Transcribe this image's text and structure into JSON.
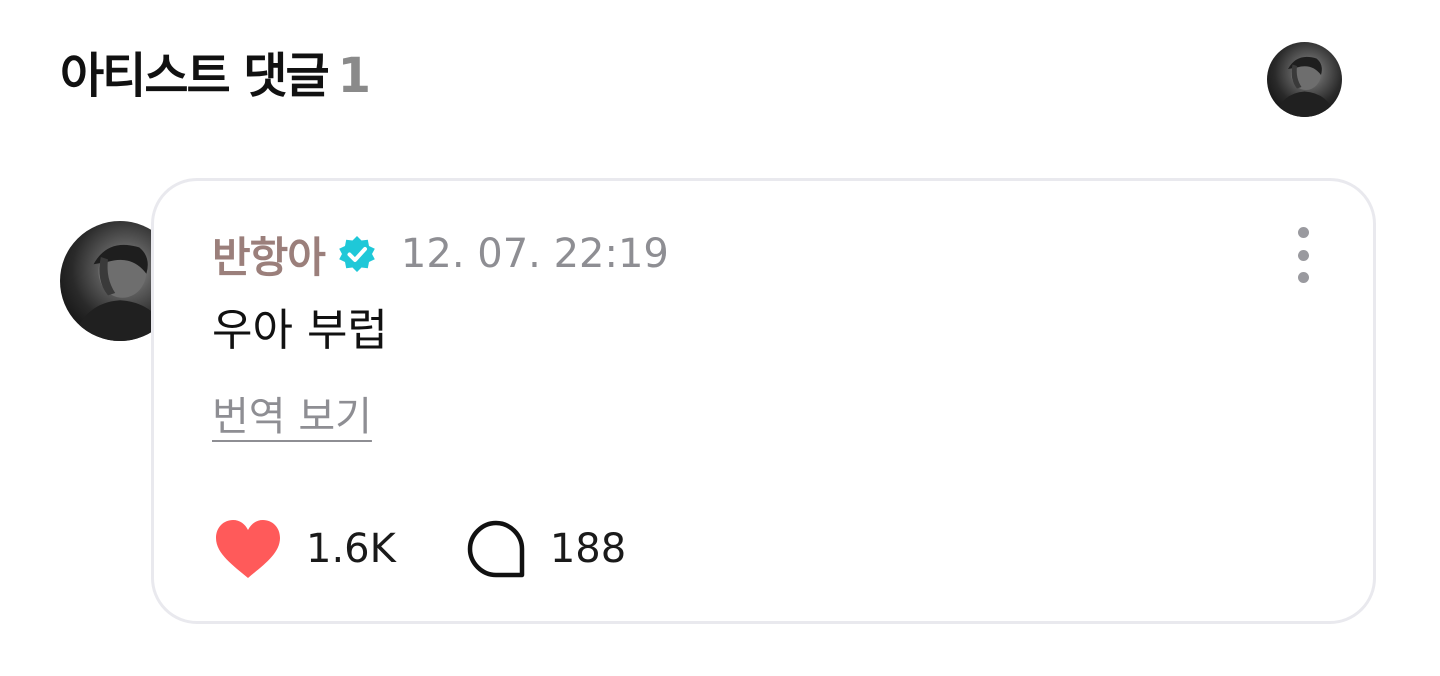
{
  "header": {
    "title": "아티스트 댓글",
    "count": "1"
  },
  "comment": {
    "author": "반항아",
    "timestamp": "12. 07. 22:19",
    "text": "우아 부럽",
    "translate_label": "번역 보기",
    "likes": "1.6K",
    "replies": "188"
  },
  "colors": {
    "author_name": "#9b7f7b",
    "verified_badge": "#1fc8d8",
    "heart": "#ff5a5a",
    "muted_text": "#8e8e93",
    "card_border": "#e9e9ee"
  },
  "icons": {
    "verified": "verified-badge-icon",
    "more": "more-vertical-icon",
    "like": "heart-icon",
    "reply": "speech-bubble-icon"
  }
}
